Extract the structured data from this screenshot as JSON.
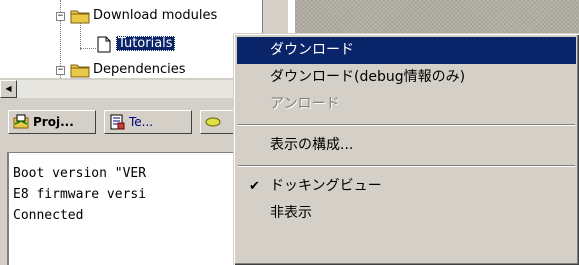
{
  "tree": {
    "items": [
      {
        "label": "Download modules",
        "expander": "−"
      },
      {
        "label": "Tutorials",
        "selected": true
      },
      {
        "label": "Dependencies",
        "expander": "−"
      }
    ]
  },
  "hscroll": {
    "left_arrow": "◀"
  },
  "tabs": [
    {
      "label": "Proj...",
      "icon": "project-icon"
    },
    {
      "label": "Te...",
      "icon": "template-icon"
    },
    {
      "label": "",
      "icon": "navigation-icon"
    }
  ],
  "output": {
    "lines": [
      "Boot version \"VER",
      "E8 firmware versi",
      "Connected"
    ]
  },
  "context_menu": {
    "items": [
      {
        "label": "ダウンロード",
        "highlighted": true
      },
      {
        "label": "ダウンロード(debug情報のみ)"
      },
      {
        "label": "アンロード",
        "disabled": true
      },
      {
        "label": "表示の構成..."
      },
      {
        "label": "ドッキングビュー",
        "checked": true,
        "check_mark": "✔"
      },
      {
        "label": "非表示"
      }
    ]
  },
  "colors": {
    "selection": "#0a246a",
    "face": "#d4d0c8",
    "folder": "#e8c848"
  }
}
